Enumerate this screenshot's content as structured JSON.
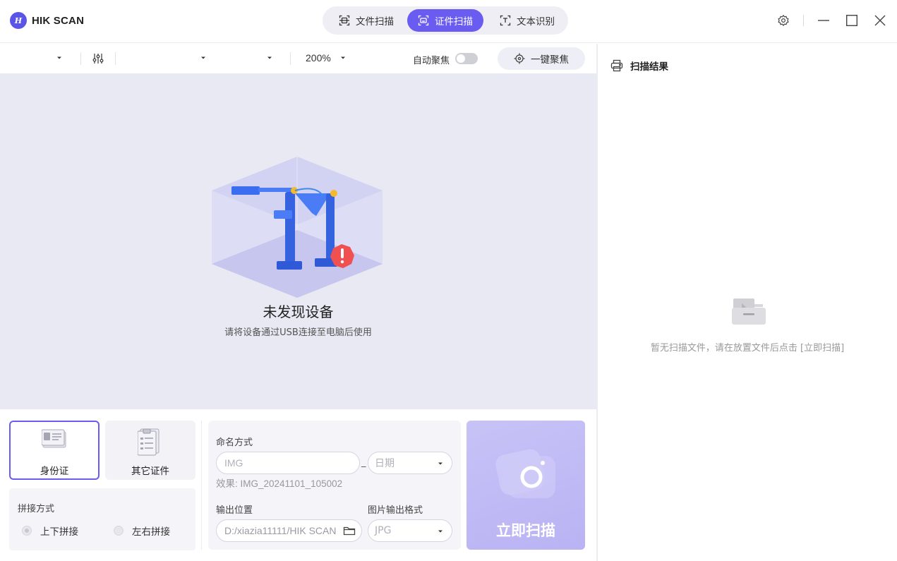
{
  "app": {
    "logo_mark": "H",
    "title": "HIK SCAN"
  },
  "mode_tabs": [
    {
      "label": "文件扫描",
      "icon": "doc-scan-icon",
      "active": false
    },
    {
      "label": "证件扫描",
      "icon": "id-scan-icon",
      "active": true
    },
    {
      "label": "文本识别",
      "icon": "text-recognition-icon",
      "active": false
    }
  ],
  "window_controls": [
    "gear-icon",
    "minimize-icon",
    "maximize-icon",
    "close-icon"
  ],
  "toolbar": {
    "zoom": "200%",
    "auto_focus_label": "自动聚焦",
    "auto_focus_on": false,
    "one_key_focus_label": "一键聚焦"
  },
  "preview": {
    "title": "未发现设备",
    "subtitle": "请将设备通过USB连接至电脑后使用"
  },
  "results": {
    "header": "扫描结果",
    "empty_text": "暂无扫描文件，请在放置文件后点击 [立即扫描]"
  },
  "doc_types": [
    {
      "label": "身份证",
      "active": true
    },
    {
      "label": "其它证件",
      "active": false
    }
  ],
  "stitch": {
    "title": "拼接方式",
    "options": [
      {
        "label": "上下拼接",
        "selected": true
      },
      {
        "label": "左右拼接",
        "selected": false
      }
    ]
  },
  "naming": {
    "title": "命名方式",
    "prefix_placeholder": "IMG",
    "separator": "_",
    "suffix_select": "日期",
    "effect": "效果: IMG_20241101_105002"
  },
  "output": {
    "location_label": "输出位置",
    "location_value": "D:/xiazia11111/HIK SCAN",
    "format_label": "图片输出格式",
    "format_value": "JPG"
  },
  "scan_button": {
    "label": "立即扫描"
  },
  "colors": {
    "accent": "#6a5cf0",
    "scan_button": "#bdb7f5",
    "preview_bg": "#e9e9f3"
  }
}
